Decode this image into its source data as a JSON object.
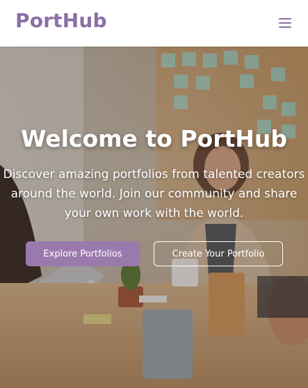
{
  "header": {
    "brand": "PortHub",
    "menu_icon": "hamburger-menu-icon"
  },
  "hero": {
    "title": "Welcome to PortHub",
    "subtitle": "Discover amazing portfolios from talented creators around the world. Join our community and share your own work with the world.",
    "primary_button": "Explore Portfolios",
    "secondary_button": "Create Your Portfolio"
  },
  "colors": {
    "brand": "#8b6fa6",
    "primary_button": "#9a7aad",
    "text_light": "#ffffff"
  }
}
